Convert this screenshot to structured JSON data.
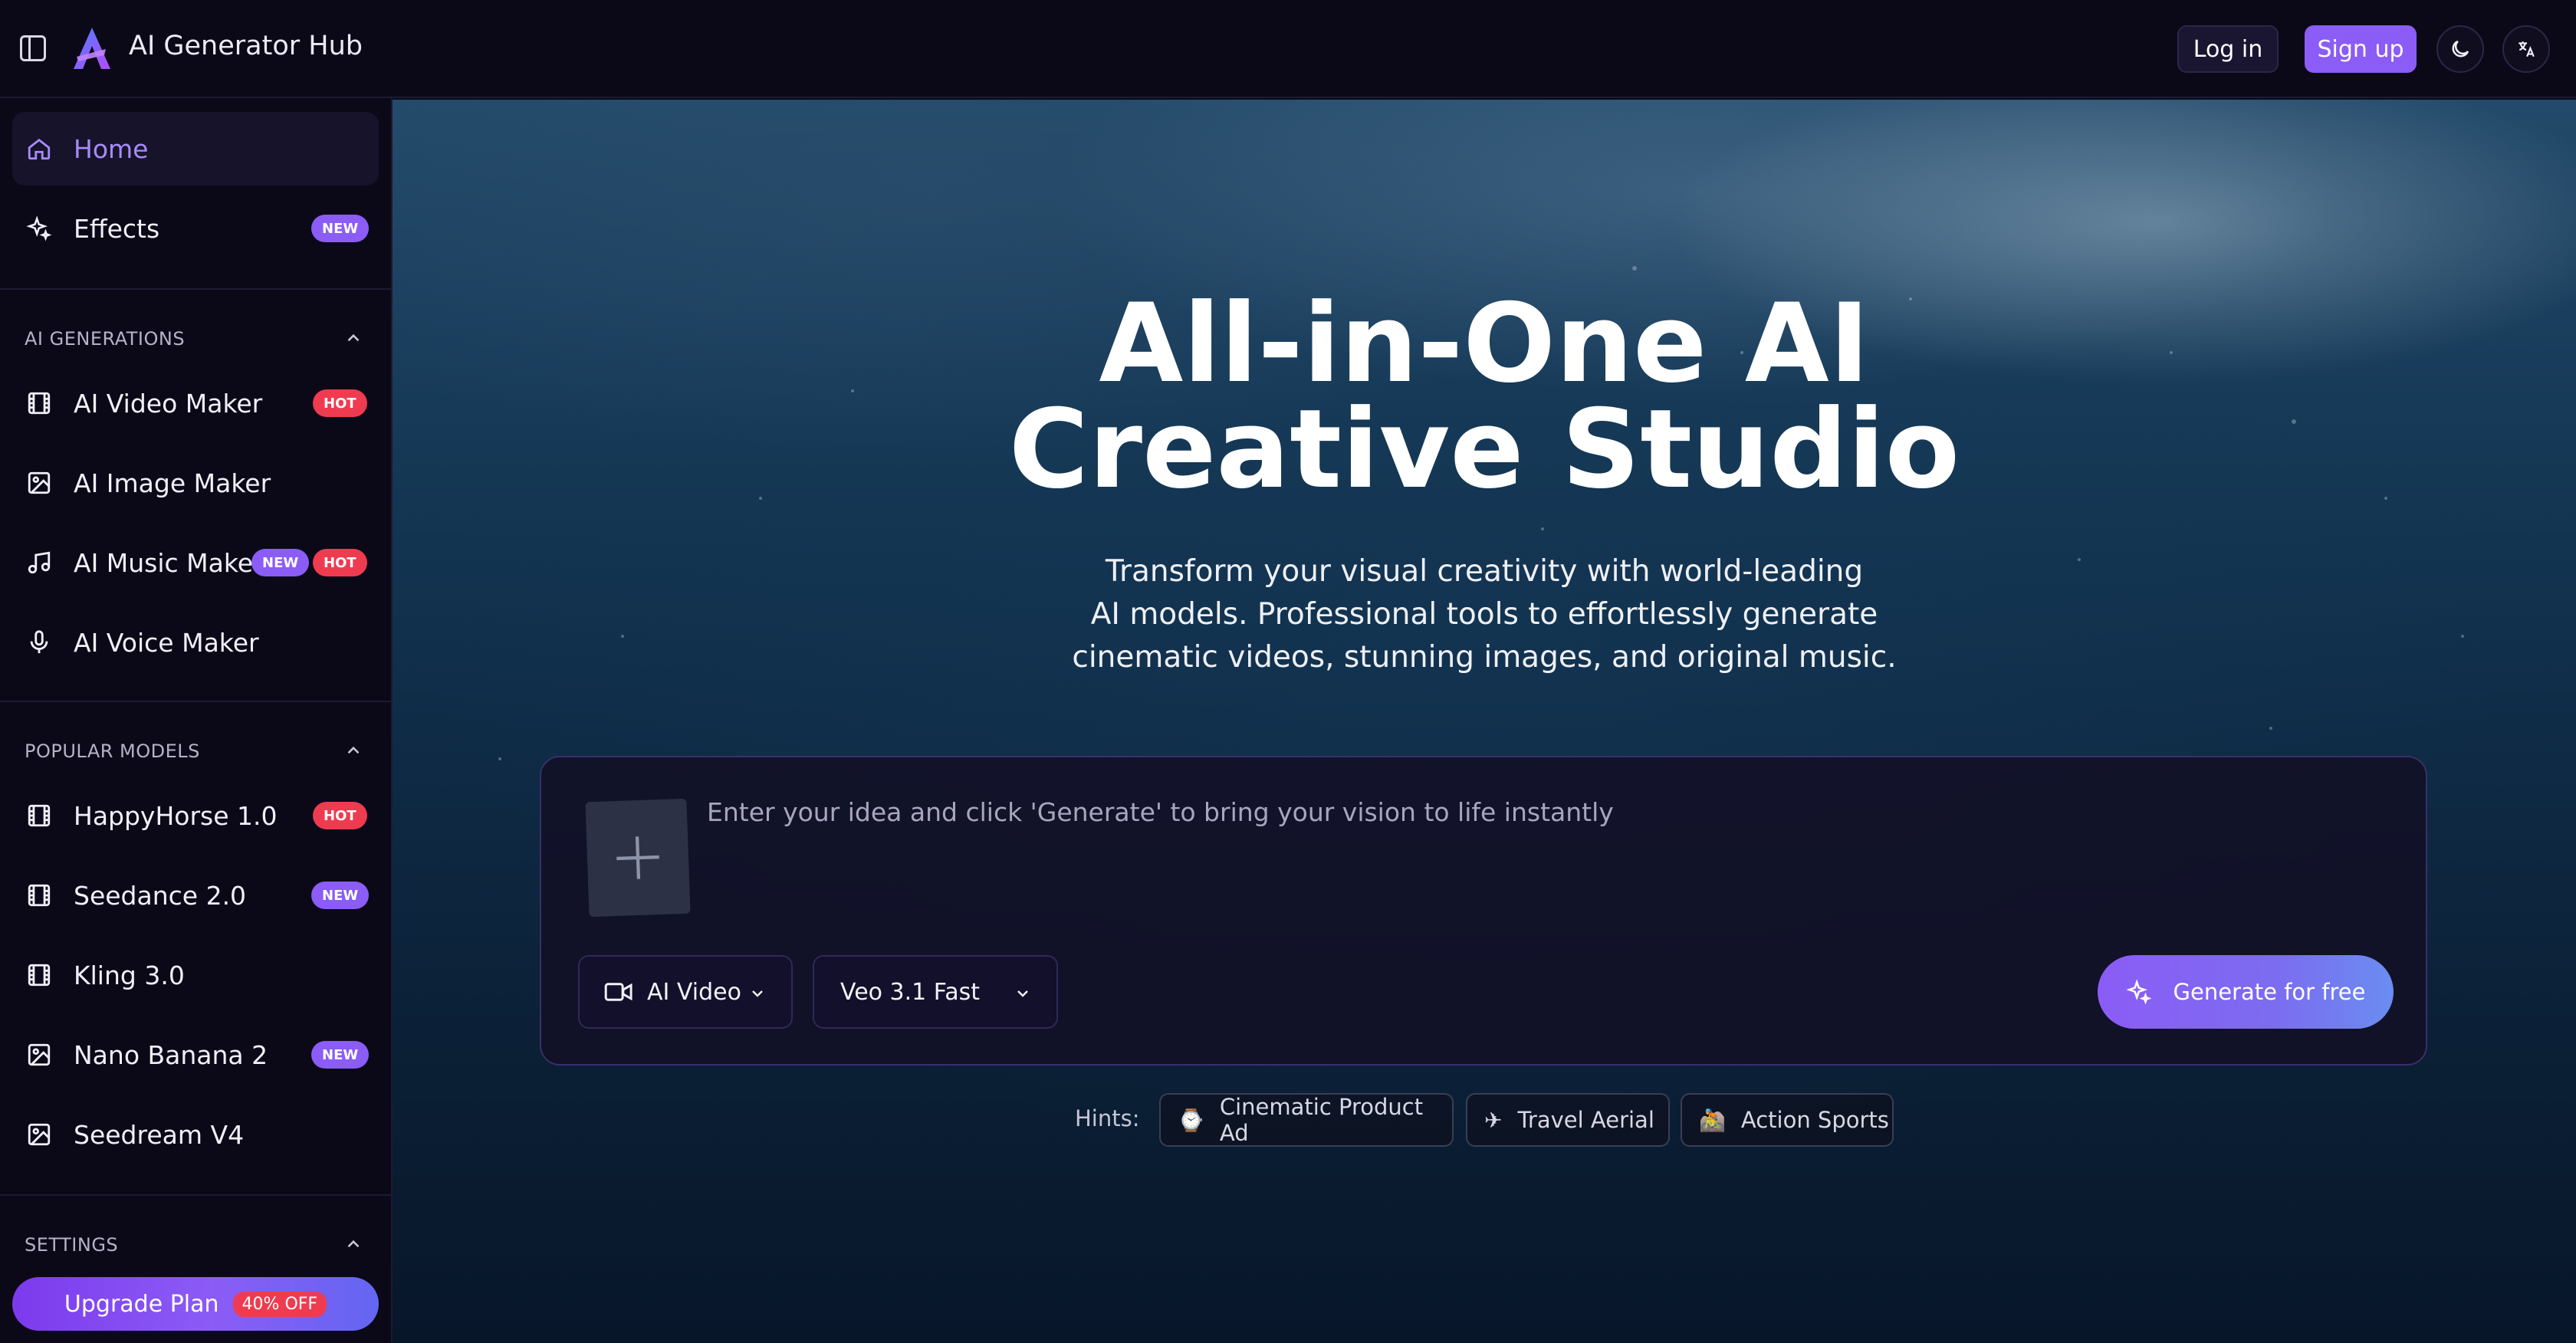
{
  "header": {
    "brand": "AI Generator Hub",
    "login_label": "Log in",
    "signup_label": "Sign up"
  },
  "sidebar": {
    "top_items": [
      {
        "label": "Home",
        "icon": "home-icon",
        "active": true
      },
      {
        "label": "Effects",
        "icon": "sparkle-icon",
        "badge": "NEW"
      }
    ],
    "sections": [
      {
        "title": "AI GENERATIONS",
        "items": [
          {
            "label": "AI Video Maker",
            "icon": "film-icon",
            "badges": [
              "HOT"
            ]
          },
          {
            "label": "AI Image Maker",
            "icon": "image-icon",
            "badges": []
          },
          {
            "label": "AI Music Maker",
            "icon": "music-icon",
            "badges": [
              "NEW",
              "HOT"
            ]
          },
          {
            "label": "AI Voice Maker",
            "icon": "mic-icon",
            "badges": []
          }
        ]
      },
      {
        "title": "POPULAR MODELS",
        "items": [
          {
            "label": "HappyHorse 1.0",
            "icon": "film-icon",
            "badges": [
              "HOT"
            ]
          },
          {
            "label": "Seedance 2.0",
            "icon": "film-icon",
            "badges": [
              "NEW"
            ]
          },
          {
            "label": "Kling 3.0",
            "icon": "film-icon",
            "badges": []
          },
          {
            "label": "Nano Banana 2",
            "icon": "image-icon",
            "badges": [
              "NEW"
            ]
          },
          {
            "label": "Seedream V4",
            "icon": "image-icon",
            "badges": []
          }
        ]
      },
      {
        "title": "SETTINGS",
        "items": []
      }
    ],
    "upgrade": {
      "label": "Upgrade Plan",
      "discount": "40% OFF"
    }
  },
  "hero": {
    "title_line1": "All-in-One AI",
    "title_line2": "Creative Studio",
    "subtitle_line1": "Transform your visual creativity with world-leading",
    "subtitle_line2": "AI models. Professional tools to effortlessly generate",
    "subtitle_line3": "cinematic videos, stunning images, and original music."
  },
  "prompt": {
    "placeholder": "Enter your idea and click 'Generate' to bring your vision to life instantly",
    "type_select": "AI Video",
    "model_select": "Veo 3.1 Fast",
    "generate_label": "Generate for free"
  },
  "hints": {
    "label": "Hints:",
    "items": [
      {
        "emoji": "⌚",
        "label": "Cinematic Product Ad"
      },
      {
        "emoji": "✈",
        "label": "Travel Aerial"
      },
      {
        "emoji": "🚵",
        "label": "Action Sports"
      }
    ]
  },
  "colors": {
    "accent": "#8b5cf6",
    "hot": "#ef3b50",
    "background": "#0b0918"
  }
}
